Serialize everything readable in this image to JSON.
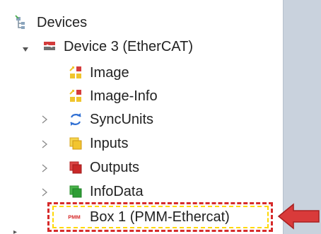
{
  "tree": {
    "root": {
      "label": "Devices",
      "icon": "devices-icon"
    },
    "device3": {
      "label": "Device 3 (EtherCAT)",
      "icon": "ethercat-device-icon"
    },
    "image": {
      "label": "Image",
      "icon": "image-icon"
    },
    "image_info": {
      "label": "Image-Info",
      "icon": "image-info-icon"
    },
    "syncunits": {
      "label": "SyncUnits",
      "icon": "sync-units-icon"
    },
    "inputs": {
      "label": "Inputs",
      "icon": "inputs-icon"
    },
    "outputs": {
      "label": "Outputs",
      "icon": "outputs-icon"
    },
    "infodata": {
      "label": "InfoData",
      "icon": "info-data-icon"
    },
    "box1": {
      "label": "Box 1 (PMM-Ethercat)",
      "icon": "pmm-box-icon",
      "icon_text": "PMM"
    }
  },
  "colors": {
    "background": "#c9d2dd",
    "highlight_red": "#d62b2b",
    "highlight_yellow": "#ffd800",
    "arrow_red": "#d93a3a"
  }
}
